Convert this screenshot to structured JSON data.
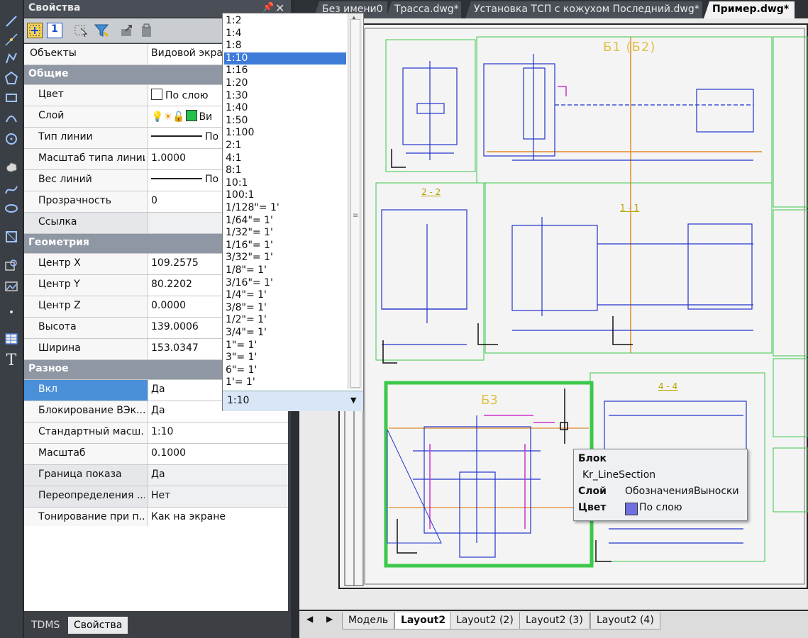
{
  "palette": {
    "title": "Свойства",
    "object_label": "Объекты",
    "object_value": "Видовой экран",
    "categories": {
      "general": "Общие",
      "geometry": "Геометрия",
      "misc": "Разное"
    },
    "general": [
      {
        "label": "Цвет",
        "value": "По слою"
      },
      {
        "label": "Слой",
        "value": "Ви"
      },
      {
        "label": "Тип линии",
        "value": "По"
      },
      {
        "label": "Масштаб типа линии",
        "value": "1.0000"
      },
      {
        "label": "Вес линий",
        "value": "По"
      },
      {
        "label": "Прозрачность",
        "value": "0"
      },
      {
        "label": "Ссылка",
        "value": ""
      }
    ],
    "geometry": [
      {
        "label": "Центр X",
        "value": "109.2575"
      },
      {
        "label": "Центр Y",
        "value": "80.2202"
      },
      {
        "label": "Центр Z",
        "value": "0.0000"
      },
      {
        "label": "Высота",
        "value": "139.0006"
      },
      {
        "label": "Ширина",
        "value": "153.0347"
      }
    ],
    "misc": [
      {
        "label": "Вкл",
        "value": "Да"
      },
      {
        "label": "Блокирование ВЭк...",
        "value": "Да"
      },
      {
        "label": "Стандартный масш...",
        "value": "1:10"
      },
      {
        "label": "Масштаб",
        "value": "0.1000"
      },
      {
        "label": "Граница показа",
        "value": "Да"
      },
      {
        "label": "Переопределения ...",
        "value": "Нет"
      },
      {
        "label": "Тонирование при п...",
        "value": "Как на экране"
      }
    ],
    "bottom_tabs": [
      "TDMS",
      "Свойства"
    ]
  },
  "scale_dropdown": {
    "options": [
      "1:2",
      "1:4",
      "1:8",
      "1:10",
      "1:16",
      "1:20",
      "1:30",
      "1:40",
      "1:50",
      "1:100",
      "2:1",
      "4:1",
      "8:1",
      "10:1",
      "100:1",
      "1/128\"= 1'",
      "1/64\"= 1'",
      "1/32\"= 1'",
      "1/16\"= 1'",
      "3/32\"= 1'",
      "1/8\"= 1'",
      "3/16\"= 1'",
      "1/4\"= 1'",
      "3/8\"= 1'",
      "1/2\"= 1'",
      "3/4\"= 1'",
      "1\"= 1'",
      "3\"= 1'",
      "6\"= 1'",
      "1'= 1'"
    ],
    "selected": "1:10",
    "current_value": "1:10"
  },
  "doc_tabs": [
    "Без имени0",
    "Трасса.dwg*",
    "Установка ТСП с кожухом Последний.dwg*",
    "Пример.dwg*"
  ],
  "active_doc_tab": "Пример.dwg*",
  "layout_tabs": [
    "Модель",
    "Layout2",
    "Layout2 (2)",
    "Layout2 (3)",
    "Layout2 (4)"
  ],
  "active_layout_tab": "Layout2",
  "drawing_labels": {
    "b1b2": "Б1 (Б2)",
    "b3": "Б3",
    "sec22": "2 - 2",
    "sec11": "1 - 1",
    "sec44": "4 - 4"
  },
  "tooltip": {
    "title": "Блок",
    "name": "Kr_LineSection",
    "layer_label": "Слой",
    "layer_value": "ОбозначенияВыноски",
    "color_label": "Цвет",
    "color_value": "По слою"
  },
  "colors": {
    "selection_blue": "#3d7bd8",
    "frame_green": "#3cc84a",
    "drawing_blue": "#2233cc",
    "layer_swatch": "#7070e0"
  }
}
